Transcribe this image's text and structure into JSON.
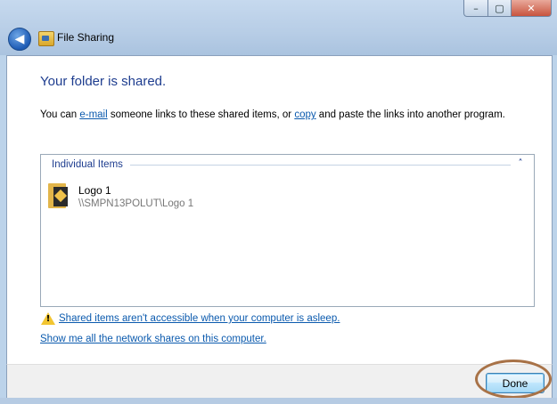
{
  "window": {
    "controls": {
      "minimize": "–",
      "maximize": "▢",
      "close": "✕"
    }
  },
  "titlebar": {
    "back_icon": "back-arrow-icon",
    "back_glyph": "◀",
    "app_icon": "file-sharing-icon",
    "title": "File Sharing"
  },
  "main": {
    "heading": "Your folder is shared.",
    "desc_prefix": "You can ",
    "email_link": "e-mail",
    "desc_middle": " someone links to these shared items, or ",
    "copy_link": "copy",
    "desc_suffix": " and paste the links into another program.",
    "items": {
      "header": "Individual Items",
      "collapse_glyph": "˄",
      "list": [
        {
          "name": "Logo 1",
          "path": "\\\\SMPN13POLUT\\Logo 1",
          "icon": "folder-icon"
        }
      ]
    },
    "warning_icon": "warning-icon",
    "warning_link": "Shared items aren't accessible when your computer is asleep.",
    "shares_link": "Show me all the network shares on this computer."
  },
  "footer": {
    "done_label": "Done"
  },
  "colors": {
    "heading": "#1e3d8f",
    "link": "#0b5aae",
    "highlight_ring": "#a87247"
  }
}
